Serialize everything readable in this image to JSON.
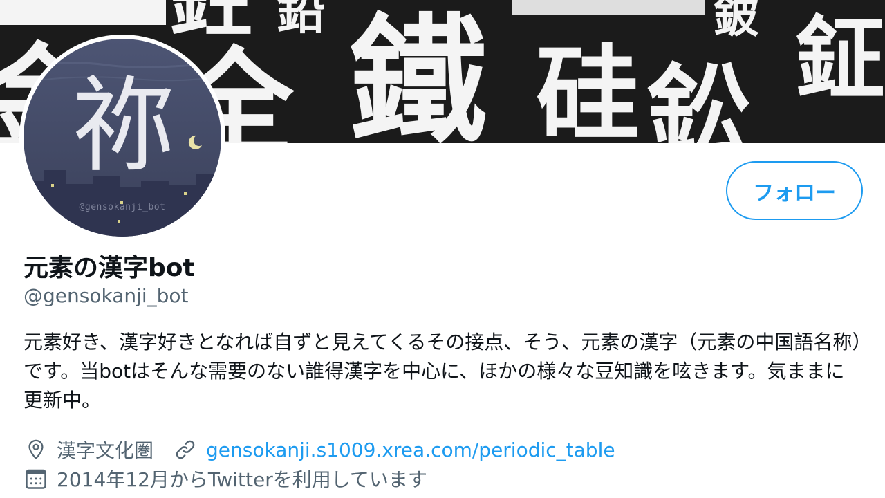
{
  "banner": {
    "glyphs": [
      "鉦",
      "鉛",
      "鈹",
      "全",
      "鐵",
      "硅",
      "鈆",
      "鉒",
      "金"
    ]
  },
  "avatar": {
    "char": "祢",
    "watermark": "@gensokanji_bot"
  },
  "profile": {
    "follow_label": "フォロー",
    "display_name": "元素の漢字bot",
    "handle": "@gensokanji_bot",
    "bio": "元素好き、漢字好きとなれば自ずと見えてくるその接点、そう、元素の漢字（元素の中国語名称）です。当botはそんな需要のない誰得漢字を中心に、ほかの様々な豆知識を呟きます。気ままに更新中。",
    "location": "漢字文化圏",
    "website": "gensokanji.s1009.xrea.com/periodic_table",
    "joined": "2014年12月からTwitterを利用しています"
  },
  "colors": {
    "accent": "#1d9bf0",
    "secondary_text": "#536471",
    "banner_bg": "#1b1b1b"
  },
  "icons": {
    "location": "location-pin-icon",
    "link": "link-icon",
    "calendar": "calendar-icon"
  }
}
